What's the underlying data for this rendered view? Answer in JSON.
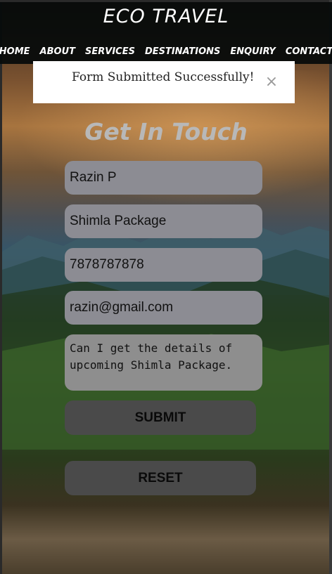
{
  "header": {
    "brand": "ECO TRAVEL",
    "nav": [
      {
        "label": "HOME"
      },
      {
        "label": "ABOUT"
      },
      {
        "label": "SERVICES"
      },
      {
        "label": "DESTINATIONS"
      },
      {
        "label": "ENQUIRY"
      },
      {
        "label": "CONTACT"
      }
    ]
  },
  "alert": {
    "message": "Form Submitted Successfully!",
    "close_glyph": "×"
  },
  "form": {
    "heading": "Get In Touch",
    "name_value": "Razin P",
    "package_value": "Shimla Package",
    "phone_value": "7878787878",
    "email_value": "razin@gmail.com",
    "message_value": "Can I get the details of upcoming Shimla Package.",
    "submit_label": "SUBMIT",
    "reset_label": "RESET"
  },
  "colors": {
    "header_bg": "#050a0a",
    "field_bg": "#8c8c93",
    "button_bg": "#4a4a4a",
    "heading": "#b8b8b8"
  },
  "icons": {
    "alert_close": "close-icon"
  }
}
